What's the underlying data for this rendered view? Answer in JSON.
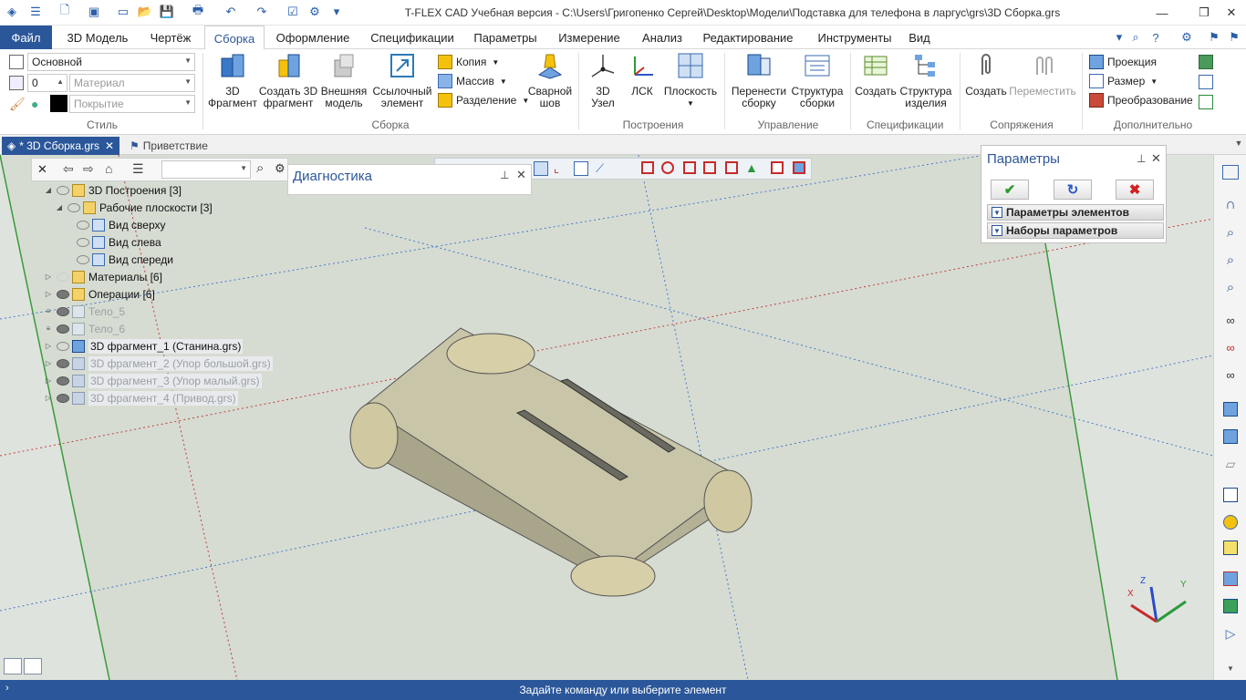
{
  "window": {
    "title": "T-FLEX CAD Учебная версия - C:\\Users\\Григопенко Сергей\\Desktop\\Модели\\Подставка для телефона в ларгус\\grs\\3D Сборка.grs",
    "min": "—",
    "restore": "❐",
    "close": "✕"
  },
  "menu": {
    "file": "Файл",
    "tabs": [
      "3D Модель",
      "Чертёж",
      "Сборка",
      "Оформление",
      "Спецификации",
      "Параметры",
      "Измерение",
      "Анализ",
      "Редактирование",
      "Инструменты",
      "Вид"
    ],
    "active": "Сборка"
  },
  "ribbon": {
    "style": {
      "layer": "Основной",
      "level": "0",
      "material": "Материал",
      "coating": "Покрытие",
      "label": "Стиль"
    },
    "assembly": {
      "label": "Сборка",
      "b1": [
        "3D",
        "Фрагмент"
      ],
      "b2": [
        "Создать 3D",
        "фрагмент"
      ],
      "b3": [
        "Внешняя",
        "модель"
      ],
      "b4": [
        "Ссылочный",
        "элемент"
      ],
      "copy": "Копия",
      "array": "Массив",
      "split": "Разделение",
      "weld": [
        "Сварной",
        "шов"
      ]
    },
    "construct": {
      "label": "Построения",
      "b1": [
        "3D",
        "Узел"
      ],
      "b2": "ЛСК",
      "b3": "Плоскость"
    },
    "manage": {
      "label": "Управление",
      "b1": [
        "Перенести",
        "сборку"
      ],
      "b2": [
        "Структура",
        "сборки"
      ]
    },
    "spec": {
      "label": "Спецификации",
      "b1": "Создать",
      "b2": [
        "Структура",
        "изделия"
      ]
    },
    "mates": {
      "label": "Сопряжения",
      "b1": "Создать",
      "b2": "Переместить"
    },
    "extra": {
      "label": "Дополнительно",
      "b1": "Проекция",
      "b2": "Размер",
      "b3": "Преобразование"
    }
  },
  "doctabs": {
    "active": "* 3D Сборка.grs",
    "other": "Приветствие"
  },
  "tree": {
    "rows": [
      {
        "label": "3D Построения [3]"
      },
      {
        "label": "Рабочие плоскости [3]"
      },
      {
        "label": "Вид сверху"
      },
      {
        "label": "Вид слева"
      },
      {
        "label": "Вид спереди"
      },
      {
        "label": "Материалы [6]"
      },
      {
        "label": "Операции [6]"
      },
      {
        "label": "Тело_5"
      },
      {
        "label": "Тело_6"
      },
      {
        "label": "3D фрагмент_1 (Станина.grs)"
      },
      {
        "label": "3D фрагмент_2 (Упор большой.grs)"
      },
      {
        "label": "3D фрагмент_3 (Упор малый.grs)"
      },
      {
        "label": "3D фрагмент_4 (Привод.grs)"
      }
    ]
  },
  "diag": {
    "title": "Диагностика"
  },
  "params": {
    "title": "Параметры",
    "sec1": "Параметры элементов",
    "sec2": "Наборы параметров"
  },
  "axes": {
    "x": "X",
    "y": "Y",
    "z": "Z"
  },
  "status": {
    "text": "Задайте команду или выберите элемент"
  },
  "colors": {
    "accent": "#2b579a",
    "viewport": "#dfe3de",
    "part_fill": "#bdb698",
    "plane_fill": "#cfd6c8"
  }
}
